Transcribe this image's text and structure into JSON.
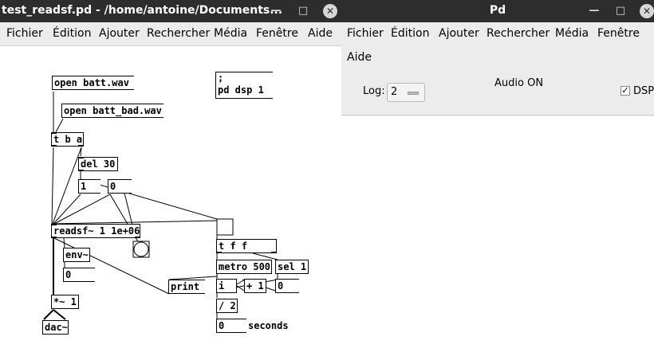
{
  "left_window": {
    "title": "test_readsf.pd  - /home/antoine/Documents...",
    "controls": {
      "minimize": "—",
      "maximize": "□",
      "close": "✕"
    },
    "menu": [
      "Fichier",
      "Édition",
      "Ajouter",
      "Rechercher",
      "Média",
      "Fenêtre",
      "Aide"
    ],
    "patch": {
      "msg_open_batt": "open batt.wav",
      "msg_open_batt_bad": "open batt_bad.wav",
      "msg_dsp_line1": ";",
      "msg_dsp_line2": "pd dsp 1",
      "obj_tba": "t b a",
      "obj_del": "del 30",
      "num_1": "1",
      "num_0a": "0",
      "obj_readsf": "readsf~ 1 1e+06",
      "obj_env": "env~",
      "num_env": "0",
      "obj_mul": "*~ 1",
      "obj_dac": "dac~",
      "obj_tff": "t f f",
      "obj_metro": "metro 500",
      "obj_sel": "sel 1",
      "num_sel": "0",
      "obj_print": "print",
      "obj_i": "i",
      "obj_plus": "+ 1",
      "obj_div": "/ 2",
      "num_seconds": "0",
      "comment_seconds": "seconds"
    }
  },
  "right_window": {
    "title": "Pd",
    "controls": {
      "minimize": "—",
      "maximize": "□",
      "close": "✕"
    },
    "menu": [
      "Fichier",
      "Édition",
      "Ajouter",
      "Rechercher",
      "Média",
      "Fenêtre",
      "Aide"
    ],
    "log_label": "Log:",
    "log_value": "2",
    "audio_status": "Audio ON",
    "dsp_label": "DSP",
    "dsp_checked": true,
    "dsp_check_glyph": "✓"
  }
}
